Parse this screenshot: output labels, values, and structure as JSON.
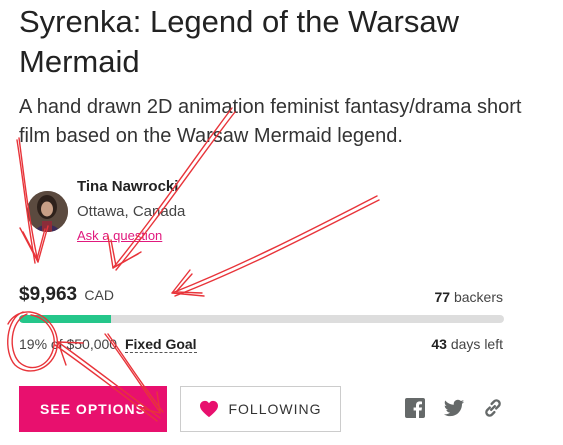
{
  "project": {
    "title": "Syrenka: Legend of the Warsaw Mermaid",
    "blurb": "A hand drawn 2D animation feminist fantasy/drama short film based on the Warsaw Mermaid legend."
  },
  "creator": {
    "name": "Tina Nawrocki",
    "location": "Ottawa, Canada",
    "ask_link": "Ask a question"
  },
  "funding": {
    "pledged": "$9,963",
    "currency": "CAD",
    "backers_count": "77",
    "backers_label": "backers",
    "progress_fraction": 0.19,
    "goal_text": "19% of $50,000",
    "goal_type": "Fixed Goal",
    "days_count": "43",
    "days_label": "days left"
  },
  "actions": {
    "see_options": "SEE OPTIONS",
    "following": "FOLLOWING"
  },
  "social_icons": [
    "facebook-icon",
    "twitter-icon",
    "link-icon"
  ],
  "colors": {
    "accent": "#e8106e",
    "progress": "#25c68a",
    "annotation": "#e8343a"
  }
}
